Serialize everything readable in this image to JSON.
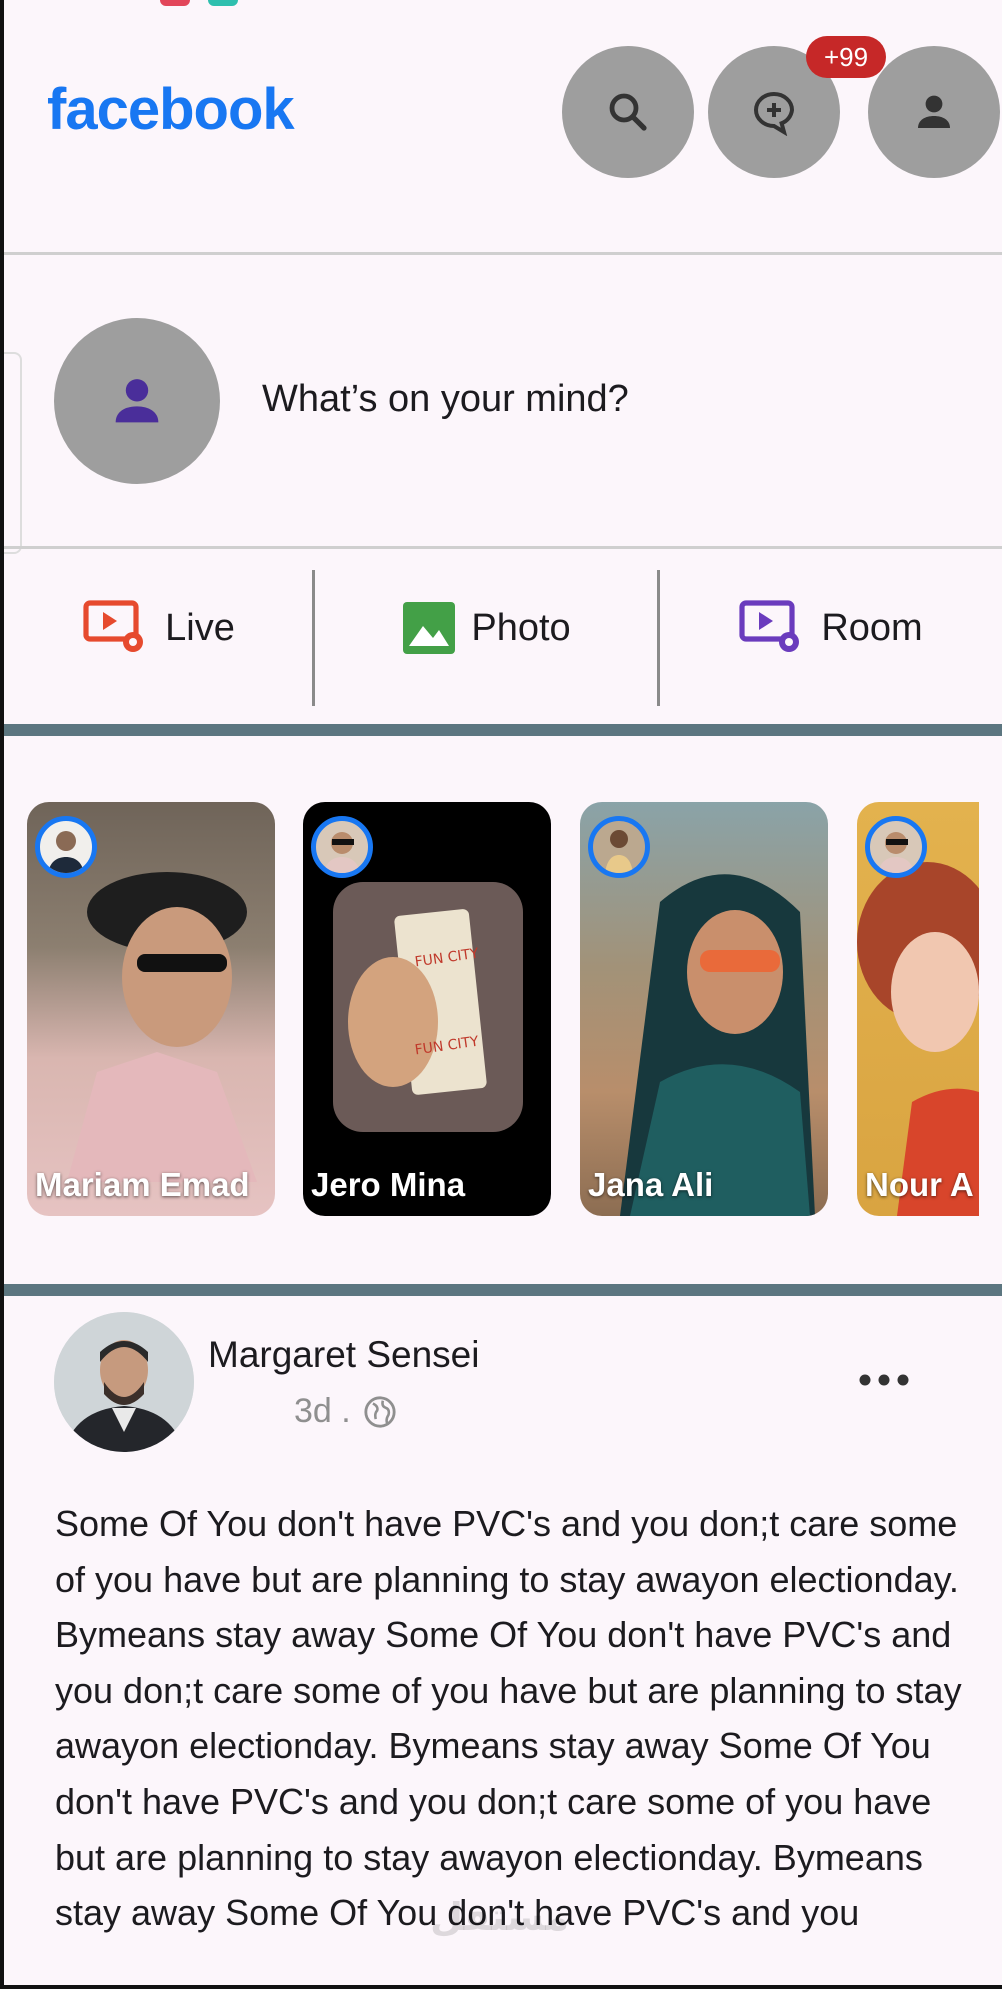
{
  "header": {
    "logo": "facebook",
    "search_icon": "search-icon",
    "messenger_icon": "chat-add-icon",
    "profile_icon": "person-icon",
    "messages_badge": "+99"
  },
  "composer": {
    "avatar_icon": "person-icon",
    "placeholder": "What’s on your mind?"
  },
  "actions": [
    {
      "label": "Live",
      "icon": "live-video-icon",
      "color": "#e64a2e"
    },
    {
      "label": "Photo",
      "icon": "photo-icon",
      "color": "#43a047"
    },
    {
      "label": "Room",
      "icon": "room-video-icon",
      "color": "#6a3bbd"
    }
  ],
  "stories": [
    {
      "name": "Mariam Emad"
    },
    {
      "name": "Jero Mina"
    },
    {
      "name": "Jana Ali"
    },
    {
      "name": "Nour A"
    }
  ],
  "post": {
    "author": "Margaret Sensei",
    "time": "3d .",
    "privacy_icon": "globe-icon",
    "more_icon": "more-horizontal-icon",
    "body": "Some Of You don't have PVC's and you don;t care some of you have but are planning to stay awayon electionday. Bymeans stay away Some Of You don't have PVC's and you don;t care some of you have but are planning to stay awayon electionday. Bymeans stay away Some Of You don't have PVC's and you don;t care some of you have but are planning to stay awayon electionday. Bymeans stay away Some Of You don't have PVC's and you"
  },
  "watermark": "مستقل",
  "colors": {
    "brand": "#1877f2",
    "badge": "#c62828",
    "icon_circle": "#9e9e9e",
    "separator_bar": "#5c7680",
    "background": "#fcf6fb"
  }
}
